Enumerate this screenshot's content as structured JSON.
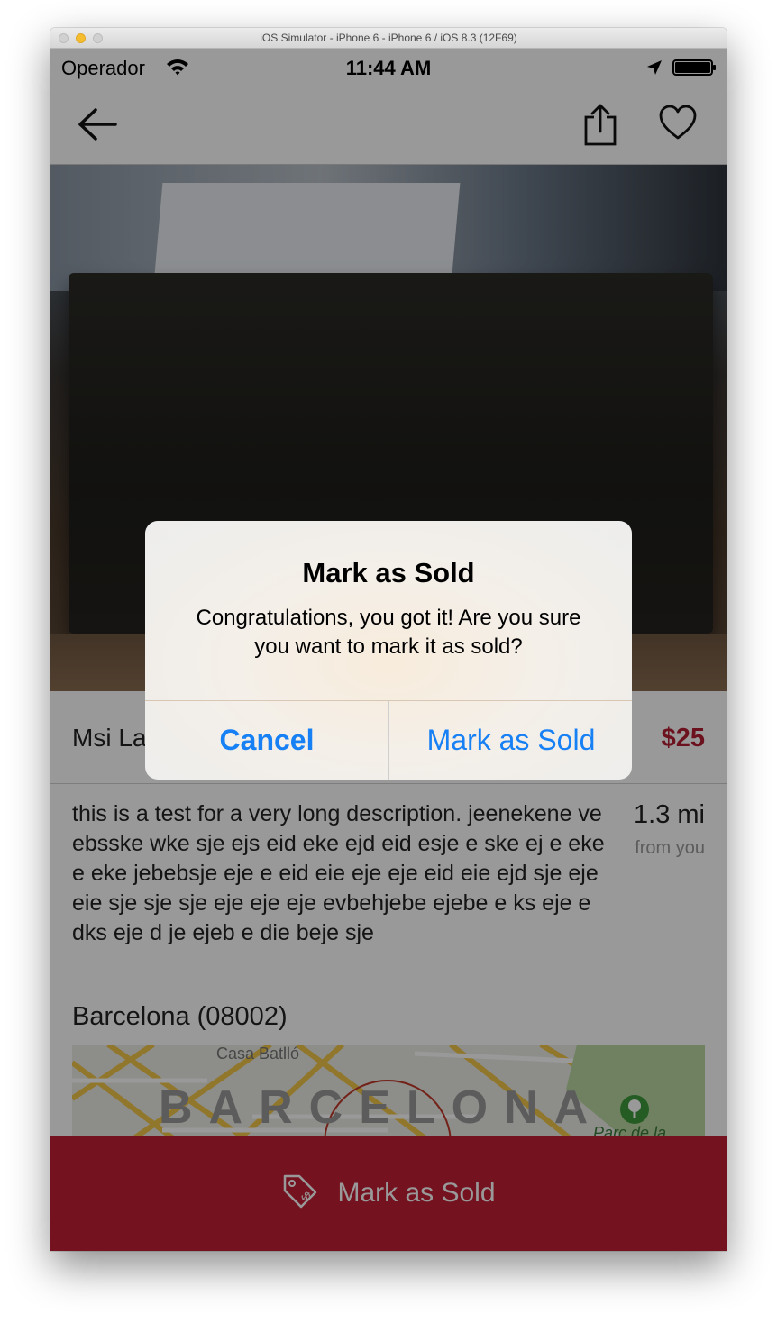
{
  "simulator": {
    "window_title": "iOS Simulator - iPhone 6 - iPhone 6 / iOS 8.3 (12F69)"
  },
  "status_bar": {
    "carrier": "Operador",
    "time": "11:44 AM",
    "icons": [
      "wifi-icon",
      "location-icon",
      "battery-icon"
    ]
  },
  "nav_bar": {
    "icons": [
      "back-arrow-icon",
      "share-icon",
      "heart-icon"
    ]
  },
  "product": {
    "title": "Msi La",
    "price": "$25",
    "description": "this is a test for a very long description. jeenekene ve ebsske wke sje ejs eid eke ejd eid esje e ske ej e eke e eke jebebsje eje e eid eie eje eje eid eie ejd sje eje eie sje sje sje eje eje eje evbehjebe ejebe e ks eje e dks eje d je ejeb e die beje sje",
    "distance": "1.3 mi",
    "distance_caption": "from you",
    "city": "Barcelona (08002)"
  },
  "map": {
    "labels": {
      "landmark": "Casa Batlló",
      "city": "BARCELONA",
      "park": "Parc de la"
    }
  },
  "bottom_bar": {
    "label": "Mark as Sold",
    "icon": "price-tag-icon"
  },
  "alert": {
    "title": "Mark as Sold",
    "message": "Congratulations, you got it! Are you sure you want to mark it as sold?",
    "cancel_label": "Cancel",
    "confirm_label": "Mark as Sold"
  },
  "colors": {
    "brand_red": "#c41e35",
    "price_red": "#b51f33",
    "ios_blue": "#1780f4"
  }
}
